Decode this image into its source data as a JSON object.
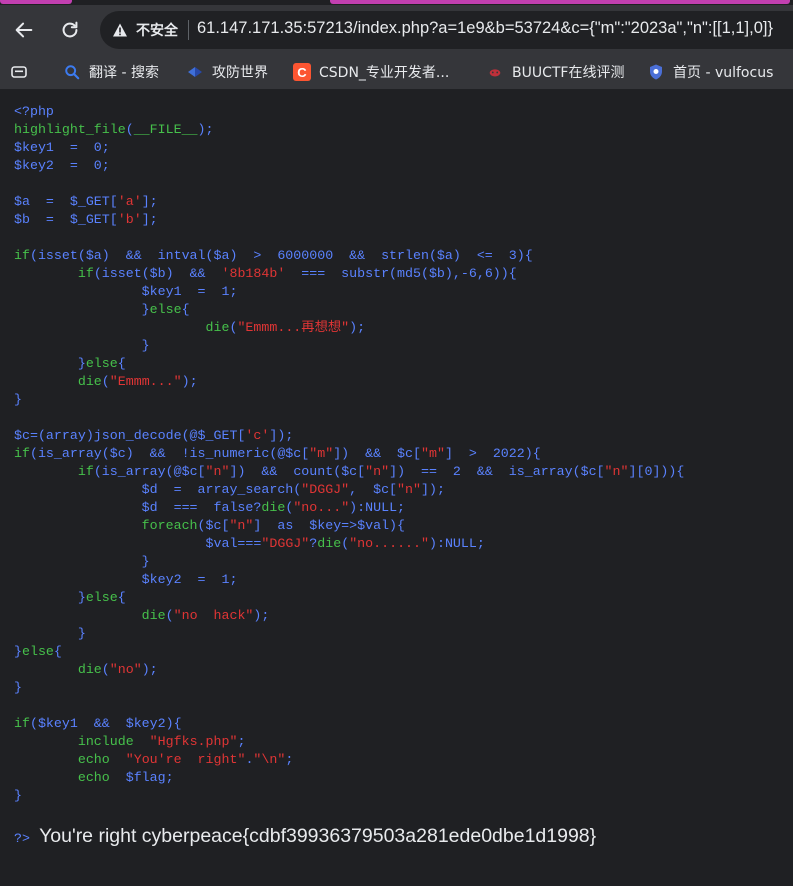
{
  "browser": {
    "security_label": "不安全",
    "url": "61.147.171.35:57213/index.php?a=1e9&b=53724&c={\"m\":\"2023a\",\"n\":[[1,1],0]}",
    "icons": {
      "back": "arrow-left-icon",
      "reload": "reload-icon",
      "warning": "warning-triangle-icon"
    }
  },
  "bookmarks": [
    {
      "label": "",
      "icon": "tab-search-icon"
    },
    {
      "label": "翻译 - 搜索",
      "icon": "search-icon"
    },
    {
      "label": "攻防世界",
      "icon": "adworld-icon"
    },
    {
      "label": "CSDN_专业开发者...",
      "icon": "csdn-icon"
    },
    {
      "label": "BUUCTF在线评测",
      "icon": "buuctf-icon"
    },
    {
      "label": "首页 - vulfocus",
      "icon": "vulfocus-icon"
    }
  ],
  "code": [
    [
      [
        "d",
        "<?php"
      ]
    ],
    [
      [
        "g",
        "highlight_file"
      ],
      [
        "d",
        "("
      ],
      [
        "g",
        "__FILE__"
      ],
      [
        "d",
        ");"
      ]
    ],
    [
      [
        "d",
        "$key1  =  0;"
      ]
    ],
    [
      [
        "d",
        "$key2  =  0;"
      ]
    ],
    [],
    [
      [
        "d",
        "$a  =  $_GET["
      ],
      [
        "s",
        "'a'"
      ],
      [
        "d",
        "];"
      ]
    ],
    [
      [
        "d",
        "$b  =  $_GET["
      ],
      [
        "s",
        "'b'"
      ],
      [
        "d",
        "];"
      ]
    ],
    [],
    [
      [
        "g",
        "if"
      ],
      [
        "d",
        "(isset($a)  &&  intval($a)  >  6000000  &&  strlen($a)  <=  3){"
      ]
    ],
    [
      [
        "d",
        "        "
      ],
      [
        "g",
        "if"
      ],
      [
        "d",
        "(isset($b)  &&  "
      ],
      [
        "s",
        "'8b184b'"
      ],
      [
        "d",
        "  ===  substr(md5($b),-6,6)){"
      ]
    ],
    [
      [
        "d",
        "                $key1  =  1;"
      ]
    ],
    [
      [
        "d",
        "                }"
      ],
      [
        "g",
        "else"
      ],
      [
        "d",
        "{"
      ]
    ],
    [
      [
        "d",
        "                        "
      ],
      [
        "g",
        "die"
      ],
      [
        "d",
        "("
      ],
      [
        "s",
        "\"Emmm...再想想\""
      ],
      [
        "d",
        ");"
      ]
    ],
    [
      [
        "d",
        "                }"
      ]
    ],
    [
      [
        "d",
        "        }"
      ],
      [
        "g",
        "else"
      ],
      [
        "d",
        "{"
      ]
    ],
    [
      [
        "d",
        "        "
      ],
      [
        "g",
        "die"
      ],
      [
        "d",
        "("
      ],
      [
        "s",
        "\"Emmm...\""
      ],
      [
        "d",
        ");"
      ]
    ],
    [
      [
        "d",
        "}"
      ]
    ],
    [],
    [
      [
        "d",
        "$c=(array)json_decode(@$_GET["
      ],
      [
        "s",
        "'c'"
      ],
      [
        "d",
        "]);"
      ]
    ],
    [
      [
        "g",
        "if"
      ],
      [
        "d",
        "(is_array($c)  &&  !is_numeric(@$c["
      ],
      [
        "s",
        "\"m\""
      ],
      [
        "d",
        "])  &&  $c["
      ],
      [
        "s",
        "\"m\""
      ],
      [
        "d",
        "]  >  2022){"
      ]
    ],
    [
      [
        "d",
        "        "
      ],
      [
        "g",
        "if"
      ],
      [
        "d",
        "(is_array(@$c["
      ],
      [
        "s",
        "\"n\""
      ],
      [
        "d",
        "])  &&  count($c["
      ],
      [
        "s",
        "\"n\""
      ],
      [
        "d",
        "])  ==  2  &&  is_array($c["
      ],
      [
        "s",
        "\"n\""
      ],
      [
        "d",
        "][0])){"
      ]
    ],
    [
      [
        "d",
        "                $d  =  array_search("
      ],
      [
        "s",
        "\"DGGJ\""
      ],
      [
        "d",
        ",  $c["
      ],
      [
        "s",
        "\"n\""
      ],
      [
        "d",
        "]);"
      ]
    ],
    [
      [
        "d",
        "                $d  ===  false?"
      ],
      [
        "g",
        "die"
      ],
      [
        "d",
        "("
      ],
      [
        "s",
        "\"no...\""
      ],
      [
        "d",
        "):NULL;"
      ]
    ],
    [
      [
        "d",
        "                "
      ],
      [
        "g",
        "foreach"
      ],
      [
        "d",
        "($c["
      ],
      [
        "s",
        "\"n\""
      ],
      [
        "d",
        "]  as  $key=>$val){"
      ]
    ],
    [
      [
        "d",
        "                        $val==="
      ],
      [
        "s",
        "\"DGGJ\""
      ],
      [
        "d",
        "?"
      ],
      [
        "g",
        "die"
      ],
      [
        "d",
        "("
      ],
      [
        "s",
        "\"no......\""
      ],
      [
        "d",
        "):NULL;"
      ]
    ],
    [
      [
        "d",
        "                }"
      ]
    ],
    [
      [
        "d",
        "                $key2  =  1;"
      ]
    ],
    [
      [
        "d",
        "        }"
      ],
      [
        "g",
        "else"
      ],
      [
        "d",
        "{"
      ]
    ],
    [
      [
        "d",
        "                "
      ],
      [
        "g",
        "die"
      ],
      [
        "d",
        "("
      ],
      [
        "s",
        "\"no  hack\""
      ],
      [
        "d",
        ");"
      ]
    ],
    [
      [
        "d",
        "        }"
      ]
    ],
    [
      [
        "d",
        "}"
      ],
      [
        "g",
        "else"
      ],
      [
        "d",
        "{"
      ]
    ],
    [
      [
        "d",
        "        "
      ],
      [
        "g",
        "die"
      ],
      [
        "d",
        "("
      ],
      [
        "s",
        "\"no\""
      ],
      [
        "d",
        ");"
      ]
    ],
    [
      [
        "d",
        "}"
      ]
    ],
    [],
    [
      [
        "g",
        "if"
      ],
      [
        "d",
        "($key1  &&  $key2){"
      ]
    ],
    [
      [
        "d",
        "        "
      ],
      [
        "g",
        "include"
      ],
      [
        "d",
        "  "
      ],
      [
        "s",
        "\"Hgfks.php\""
      ],
      [
        "d",
        ";"
      ]
    ],
    [
      [
        "d",
        "        "
      ],
      [
        "g",
        "echo"
      ],
      [
        "d",
        "  "
      ],
      [
        "s",
        "\"You're  right\""
      ],
      [
        "d",
        "."
      ],
      [
        "s",
        "\"\\n\""
      ],
      [
        "d",
        ";"
      ]
    ],
    [
      [
        "d",
        "        "
      ],
      [
        "g",
        "echo"
      ],
      [
        "d",
        "  $flag;"
      ]
    ],
    [
      [
        "d",
        "}"
      ]
    ]
  ],
  "result": {
    "tag": "?>",
    "message": "You're right cyberpeace{cdbf39936379503a281ede0dbe1d1998}"
  },
  "colors": {
    "default": "#5a82ff",
    "string": "#e03535",
    "keyword": "#46c04b",
    "background": "#1f2023"
  }
}
